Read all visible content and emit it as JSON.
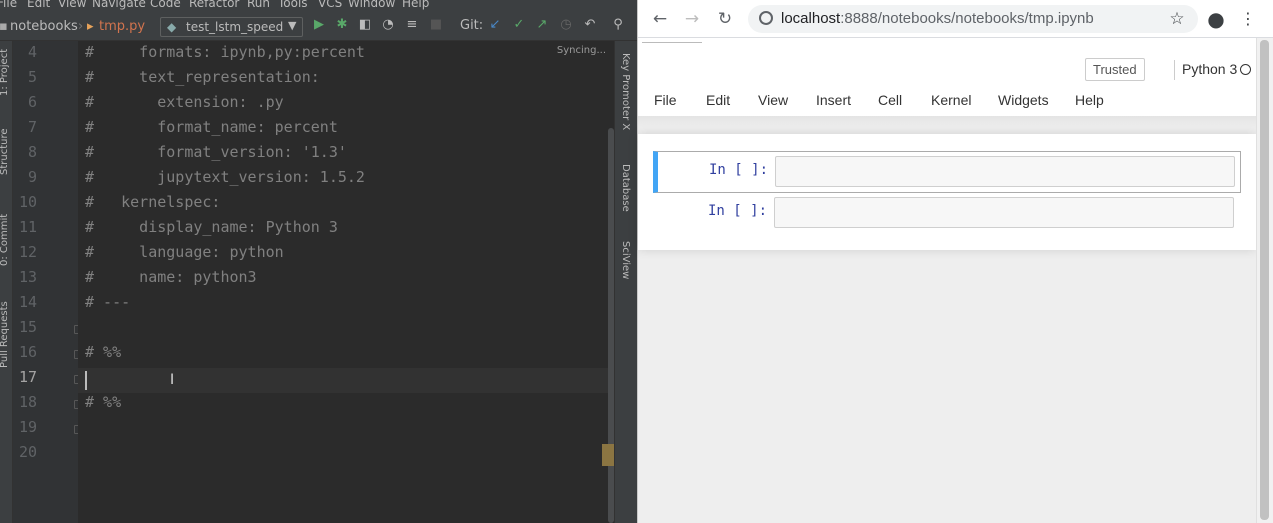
{
  "ide": {
    "menu": [
      "File",
      "Edit",
      "View",
      "Navigate",
      "Code",
      "Refactor",
      "Run",
      "Tools",
      "VCS",
      "Window",
      "Help"
    ],
    "breadcrumb": {
      "folder": "notebooks",
      "file": "tmp.py"
    },
    "run_config": "test_lstm_speed",
    "git_label": "Git:",
    "syncing": "Syncing...",
    "left_tabs": [
      "1: Project",
      "Structure",
      "0: Commit",
      "Pull Requests"
    ],
    "right_tabs": [
      "Key Promoter X",
      "Database",
      "SciView"
    ],
    "lines": [
      {
        "n": "4",
        "text": "#     formats: ipynb,py:percent"
      },
      {
        "n": "5",
        "text": "#     text_representation:"
      },
      {
        "n": "6",
        "text": "#       extension: .py"
      },
      {
        "n": "7",
        "text": "#       format_name: percent"
      },
      {
        "n": "8",
        "text": "#       format_version: '1.3'"
      },
      {
        "n": "9",
        "text": "#       jupytext_version: 1.5.2"
      },
      {
        "n": "10",
        "text": "#   kernelspec:"
      },
      {
        "n": "11",
        "text": "#     display_name: Python 3"
      },
      {
        "n": "12",
        "text": "#     language: python"
      },
      {
        "n": "13",
        "text": "#     name: python3"
      },
      {
        "n": "14",
        "text": "# ---"
      },
      {
        "n": "15",
        "text": ""
      },
      {
        "n": "16",
        "text": "# %%"
      },
      {
        "n": "17",
        "text": ""
      },
      {
        "n": "18",
        "text": "# %%"
      },
      {
        "n": "19",
        "text": ""
      },
      {
        "n": "20",
        "text": ""
      }
    ],
    "current_line": "17"
  },
  "browser": {
    "url_host": "localhost",
    "url_rest": ":8888/notebooks/notebooks/tmp.ipynb",
    "notebook": {
      "trusted": "Trusted",
      "kernel": "Python 3",
      "menu": [
        "File",
        "Edit",
        "View",
        "Insert",
        "Cell",
        "Kernel",
        "Widgets",
        "Help"
      ],
      "cells": [
        {
          "prompt": "In [ ]:"
        },
        {
          "prompt": "In [ ]:"
        }
      ]
    }
  },
  "colors": {
    "ide_bg": "#2b2b2b",
    "comment": "#808080",
    "selected_cell_bar": "#42a5f5",
    "prompt": "#303f9f"
  }
}
